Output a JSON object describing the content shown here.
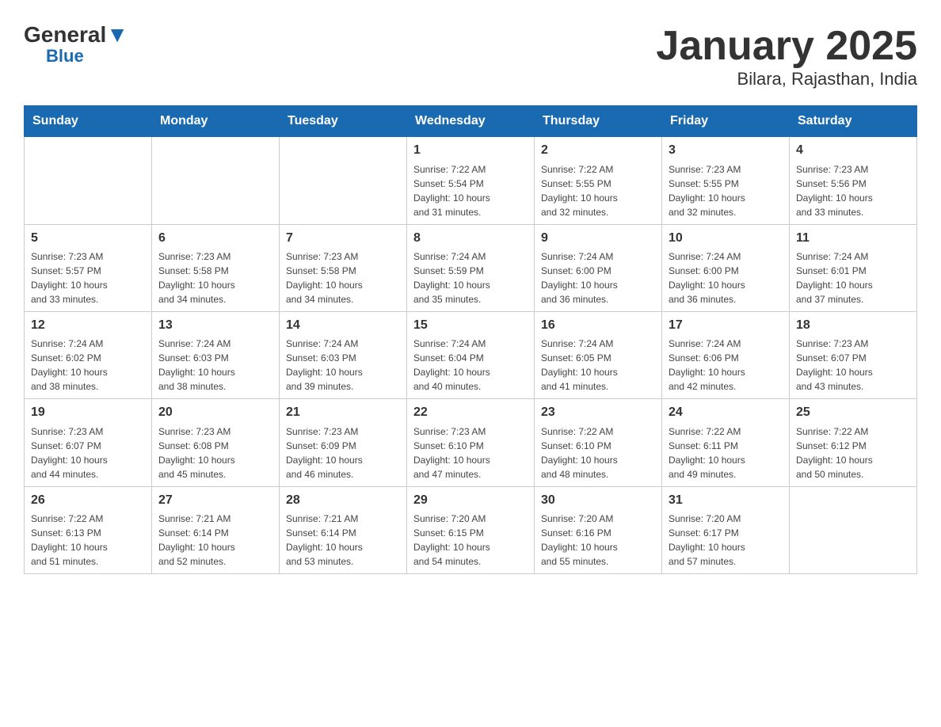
{
  "header": {
    "logo_general": "General",
    "logo_blue": "Blue",
    "title": "January 2025",
    "subtitle": "Bilara, Rajasthan, India"
  },
  "days_of_week": [
    "Sunday",
    "Monday",
    "Tuesday",
    "Wednesday",
    "Thursday",
    "Friday",
    "Saturday"
  ],
  "weeks": [
    [
      {
        "day": "",
        "info": ""
      },
      {
        "day": "",
        "info": ""
      },
      {
        "day": "",
        "info": ""
      },
      {
        "day": "1",
        "info": "Sunrise: 7:22 AM\nSunset: 5:54 PM\nDaylight: 10 hours\nand 31 minutes."
      },
      {
        "day": "2",
        "info": "Sunrise: 7:22 AM\nSunset: 5:55 PM\nDaylight: 10 hours\nand 32 minutes."
      },
      {
        "day": "3",
        "info": "Sunrise: 7:23 AM\nSunset: 5:55 PM\nDaylight: 10 hours\nand 32 minutes."
      },
      {
        "day": "4",
        "info": "Sunrise: 7:23 AM\nSunset: 5:56 PM\nDaylight: 10 hours\nand 33 minutes."
      }
    ],
    [
      {
        "day": "5",
        "info": "Sunrise: 7:23 AM\nSunset: 5:57 PM\nDaylight: 10 hours\nand 33 minutes."
      },
      {
        "day": "6",
        "info": "Sunrise: 7:23 AM\nSunset: 5:58 PM\nDaylight: 10 hours\nand 34 minutes."
      },
      {
        "day": "7",
        "info": "Sunrise: 7:23 AM\nSunset: 5:58 PM\nDaylight: 10 hours\nand 34 minutes."
      },
      {
        "day": "8",
        "info": "Sunrise: 7:24 AM\nSunset: 5:59 PM\nDaylight: 10 hours\nand 35 minutes."
      },
      {
        "day": "9",
        "info": "Sunrise: 7:24 AM\nSunset: 6:00 PM\nDaylight: 10 hours\nand 36 minutes."
      },
      {
        "day": "10",
        "info": "Sunrise: 7:24 AM\nSunset: 6:00 PM\nDaylight: 10 hours\nand 36 minutes."
      },
      {
        "day": "11",
        "info": "Sunrise: 7:24 AM\nSunset: 6:01 PM\nDaylight: 10 hours\nand 37 minutes."
      }
    ],
    [
      {
        "day": "12",
        "info": "Sunrise: 7:24 AM\nSunset: 6:02 PM\nDaylight: 10 hours\nand 38 minutes."
      },
      {
        "day": "13",
        "info": "Sunrise: 7:24 AM\nSunset: 6:03 PM\nDaylight: 10 hours\nand 38 minutes."
      },
      {
        "day": "14",
        "info": "Sunrise: 7:24 AM\nSunset: 6:03 PM\nDaylight: 10 hours\nand 39 minutes."
      },
      {
        "day": "15",
        "info": "Sunrise: 7:24 AM\nSunset: 6:04 PM\nDaylight: 10 hours\nand 40 minutes."
      },
      {
        "day": "16",
        "info": "Sunrise: 7:24 AM\nSunset: 6:05 PM\nDaylight: 10 hours\nand 41 minutes."
      },
      {
        "day": "17",
        "info": "Sunrise: 7:24 AM\nSunset: 6:06 PM\nDaylight: 10 hours\nand 42 minutes."
      },
      {
        "day": "18",
        "info": "Sunrise: 7:23 AM\nSunset: 6:07 PM\nDaylight: 10 hours\nand 43 minutes."
      }
    ],
    [
      {
        "day": "19",
        "info": "Sunrise: 7:23 AM\nSunset: 6:07 PM\nDaylight: 10 hours\nand 44 minutes."
      },
      {
        "day": "20",
        "info": "Sunrise: 7:23 AM\nSunset: 6:08 PM\nDaylight: 10 hours\nand 45 minutes."
      },
      {
        "day": "21",
        "info": "Sunrise: 7:23 AM\nSunset: 6:09 PM\nDaylight: 10 hours\nand 46 minutes."
      },
      {
        "day": "22",
        "info": "Sunrise: 7:23 AM\nSunset: 6:10 PM\nDaylight: 10 hours\nand 47 minutes."
      },
      {
        "day": "23",
        "info": "Sunrise: 7:22 AM\nSunset: 6:10 PM\nDaylight: 10 hours\nand 48 minutes."
      },
      {
        "day": "24",
        "info": "Sunrise: 7:22 AM\nSunset: 6:11 PM\nDaylight: 10 hours\nand 49 minutes."
      },
      {
        "day": "25",
        "info": "Sunrise: 7:22 AM\nSunset: 6:12 PM\nDaylight: 10 hours\nand 50 minutes."
      }
    ],
    [
      {
        "day": "26",
        "info": "Sunrise: 7:22 AM\nSunset: 6:13 PM\nDaylight: 10 hours\nand 51 minutes."
      },
      {
        "day": "27",
        "info": "Sunrise: 7:21 AM\nSunset: 6:14 PM\nDaylight: 10 hours\nand 52 minutes."
      },
      {
        "day": "28",
        "info": "Sunrise: 7:21 AM\nSunset: 6:14 PM\nDaylight: 10 hours\nand 53 minutes."
      },
      {
        "day": "29",
        "info": "Sunrise: 7:20 AM\nSunset: 6:15 PM\nDaylight: 10 hours\nand 54 minutes."
      },
      {
        "day": "30",
        "info": "Sunrise: 7:20 AM\nSunset: 6:16 PM\nDaylight: 10 hours\nand 55 minutes."
      },
      {
        "day": "31",
        "info": "Sunrise: 7:20 AM\nSunset: 6:17 PM\nDaylight: 10 hours\nand 57 minutes."
      },
      {
        "day": "",
        "info": ""
      }
    ]
  ]
}
